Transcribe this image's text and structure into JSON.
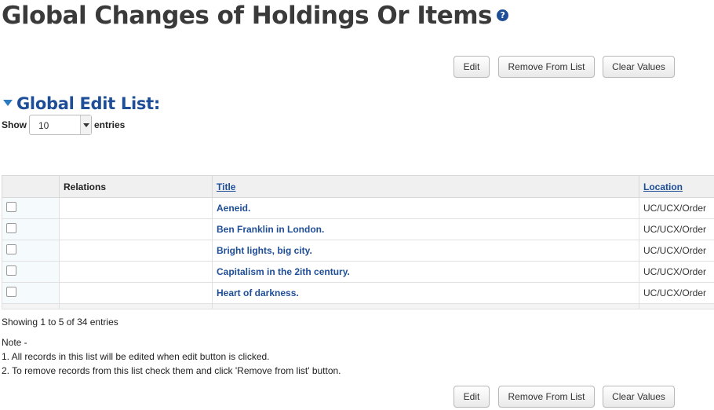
{
  "page": {
    "title": "Global Changes of Holdings Or Items",
    "help_icon": "question-circle-icon",
    "help_glyph": "?"
  },
  "toolbar": {
    "edit_label": "Edit",
    "remove_label": "Remove From List",
    "clear_label": "Clear Values"
  },
  "section": {
    "title": "Global Edit List:",
    "toggle_icon": "caret-down-icon"
  },
  "length_menu": {
    "show_label": "Show",
    "selected": "10",
    "entries_label": "entries"
  },
  "table": {
    "columns": [
      "",
      "Relations",
      "Title",
      "Location"
    ],
    "rows": [
      {
        "relations": "",
        "title": "Aeneid.",
        "location": "UC/UCX/Order"
      },
      {
        "relations": "",
        "title": "Ben Franklin in London.",
        "location": "UC/UCX/Order"
      },
      {
        "relations": "",
        "title": "Bright lights, big city.",
        "location": "UC/UCX/Order"
      },
      {
        "relations": "",
        "title": "Capitalism in the 2ith century.",
        "location": "UC/UCX/Order"
      },
      {
        "relations": "",
        "title": "Heart of darkness.",
        "location": "UC/UCX/Order"
      }
    ]
  },
  "info": "Showing 1 to 5 of 34 entries",
  "notes": {
    "heading": "Note -",
    "line1": "1. All records in this list will be edited when edit button is clicked.",
    "line2": "2. To remove records from this list check them and click 'Remove from list' button."
  },
  "colors": {
    "link": "#1f4e99",
    "title": "#3a3a3a"
  }
}
